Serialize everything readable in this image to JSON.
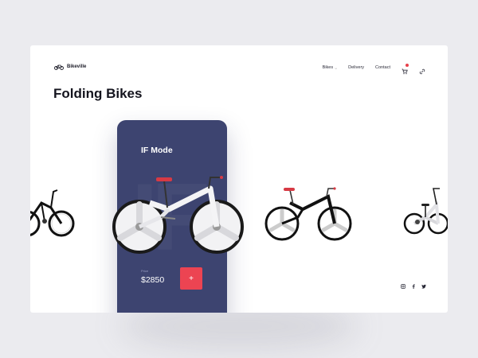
{
  "brand": {
    "name": "Bikeville"
  },
  "nav": {
    "items": [
      {
        "label": "Bikes",
        "has_dropdown": true
      },
      {
        "label": "Delivery",
        "has_dropdown": false
      },
      {
        "label": "Contact",
        "has_dropdown": false
      }
    ],
    "icons": [
      "cart-icon",
      "link-icon"
    ]
  },
  "page": {
    "title": "Folding Bikes"
  },
  "featured": {
    "name": "IF Mode",
    "watermark": "IF",
    "price_label": "Price",
    "price": "$2850",
    "add_label": "+"
  },
  "social": {
    "icons": [
      "instagram-icon",
      "facebook-icon",
      "twitter-icon"
    ]
  },
  "colors": {
    "background": "#ebebef",
    "card": "#ffffff",
    "panel": "#3d4470",
    "accent": "#ec4452",
    "text_dark": "#14141e"
  }
}
